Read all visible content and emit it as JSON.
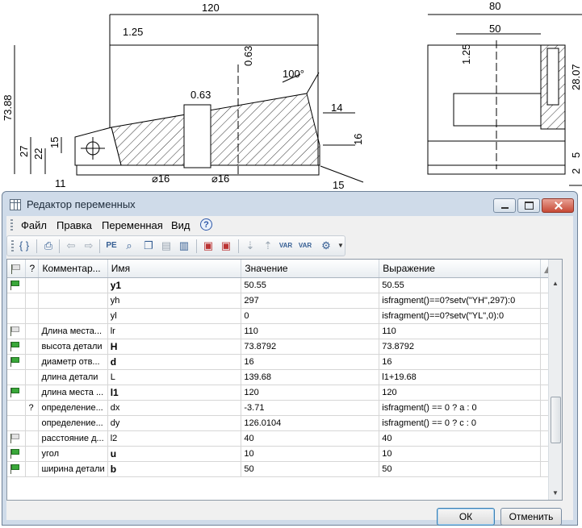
{
  "drawing": {
    "dim_120": "120",
    "dim_80": "80",
    "dim_50": "50",
    "rough_125_left": "1.25",
    "rough_125_right": "1.25",
    "rough_063_top": "0.63",
    "rough_063_mid": "0.63",
    "angle_100": "100°",
    "dim_73_88": "73.88",
    "dim_27": "27",
    "dim_22": "22",
    "dim_15_left": "15",
    "dim_11": "11",
    "dim_14": "14",
    "dim_16_right": "16",
    "dim_15_bottom": "15",
    "dia_16_a": "⌀16",
    "dia_16_b": "⌀16",
    "dim_28": "28.07",
    "dim_5": "5",
    "dim_2": "2"
  },
  "window": {
    "title": "Редактор переменных",
    "min_icon": "minimize-icon",
    "max_icon": "maximize-icon",
    "close_icon": "close-icon"
  },
  "menu": {
    "file": "Файл",
    "edit": "Правка",
    "variable": "Переменная",
    "view": "Вид",
    "help": "?"
  },
  "toolbar": {
    "icons": [
      "new-variable-icon",
      "print-icon",
      "undo-icon",
      "redo-icon",
      "pe-icon",
      "find-icon",
      "copy-icon",
      "paste-icon",
      "delete-icon",
      "export-icon",
      "import-icon",
      "sort-asc-icon",
      "sort-desc-icon",
      "var-icon",
      "check-var-icon",
      "settings-icon"
    ]
  },
  "table": {
    "headers": {
      "flag": "",
      "q": "?",
      "comment": "Комментар...",
      "name": "Имя",
      "value": "Значение",
      "expr": "Выражение"
    },
    "rows": [
      {
        "flag": "green",
        "q": "",
        "comment": "",
        "name": "y1",
        "bold": true,
        "value": "50.55",
        "expr": "50.55"
      },
      {
        "flag": "",
        "q": "",
        "comment": "",
        "name": "yh",
        "bold": false,
        "value": "297",
        "expr": "isfragment()==0?setv(\"YH\",297):0"
      },
      {
        "flag": "",
        "q": "",
        "comment": "",
        "name": "yl",
        "bold": false,
        "value": "0",
        "expr": "isfragment()==0?setv(\"YL\",0):0"
      },
      {
        "flag": "gray",
        "q": "",
        "comment": "Длина места...",
        "name": "lr",
        "bold": false,
        "value": "110",
        "expr": "110"
      },
      {
        "flag": "green",
        "q": "",
        "comment": "высота детали",
        "name": "H",
        "bold": true,
        "value": "73.8792",
        "expr": "73.8792"
      },
      {
        "flag": "green",
        "q": "",
        "comment": "диаметр отв...",
        "name": "d",
        "bold": true,
        "value": "16",
        "expr": "16"
      },
      {
        "flag": "",
        "q": "",
        "comment": "длина детали",
        "name": "L",
        "bold": false,
        "value": "139.68",
        "expr": "l1+19.68"
      },
      {
        "flag": "green",
        "q": "",
        "comment": "длина места ...",
        "name": "l1",
        "bold": true,
        "value": "120",
        "expr": "120"
      },
      {
        "flag": "",
        "q": "?",
        "comment": "определение...",
        "name": "dx",
        "bold": false,
        "value": "-3.71",
        "expr": "isfragment() == 0 ? a : 0"
      },
      {
        "flag": "",
        "q": "",
        "comment": "определение...",
        "name": "dy",
        "bold": false,
        "value": "126.0104",
        "expr": "isfragment() == 0 ? c : 0"
      },
      {
        "flag": "gray",
        "q": "",
        "comment": "расстояние д...",
        "name": "l2",
        "bold": false,
        "value": "40",
        "expr": "40"
      },
      {
        "flag": "green",
        "q": "",
        "comment": "угол",
        "name": "u",
        "bold": true,
        "value": "10",
        "expr": "10"
      },
      {
        "flag": "green",
        "q": "",
        "comment": "ширина детали",
        "name": "b",
        "bold": true,
        "value": "50",
        "expr": "50"
      }
    ]
  },
  "buttons": {
    "ok": "ОК",
    "cancel": "Отменить"
  }
}
